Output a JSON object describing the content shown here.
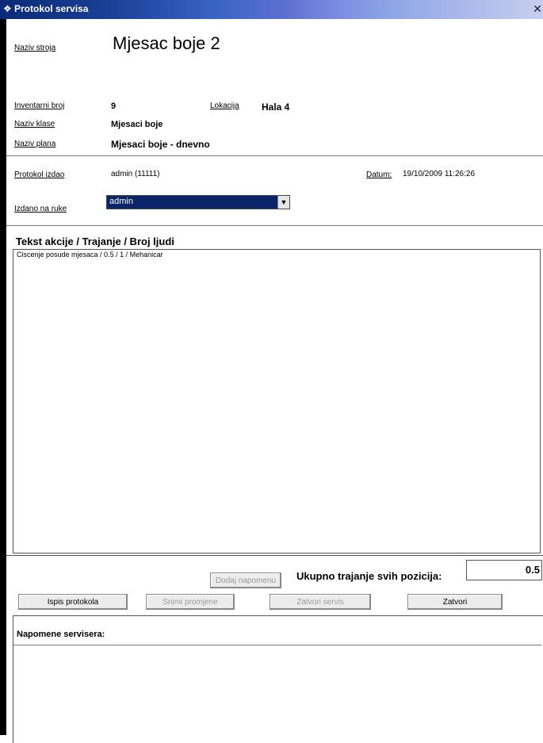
{
  "window": {
    "title": "Protokol servisa"
  },
  "header": {
    "machine_label": "Naziv stroja",
    "machine_value": "Mjesac boje 2",
    "inventory_label": "Inventarni broj",
    "inventory_value": "9",
    "location_label": "Lokacija",
    "location_value": "Hala 4",
    "class_label": "Naziv klase",
    "class_value": "Mjesaci boje",
    "plan_label": "Naziv plana",
    "plan_value": "Mjesaci boje - dnevno"
  },
  "issue": {
    "issued_label": "Protokol izdao",
    "issued_value": "admin (11111)",
    "date_label": "Datum:",
    "date_value": "19/10/2009 11:26:26",
    "handed_label": "Izdano na ruke",
    "handed_value": "admin"
  },
  "actions": {
    "header": "Tekst akcije  /  Trajanje  /  Broj ljudi",
    "rows": [
      "Ciscenje posude mjesaca  /  0.5  /  1 / Mehanicar"
    ]
  },
  "controls": {
    "add_note": "Dodaj napomenu",
    "total_label": "Ukupno trajanje svih pozicija:",
    "total_value": "0.5",
    "print": "Ispis protokola",
    "save": "Snimi promjene",
    "close_service": "Zatvori servis",
    "close": "Zatvori"
  },
  "notes": {
    "label": "Napomene servisera:"
  },
  "colors": {
    "select_bg": "#0a246a",
    "titlebar_start": "#0a2a78"
  }
}
